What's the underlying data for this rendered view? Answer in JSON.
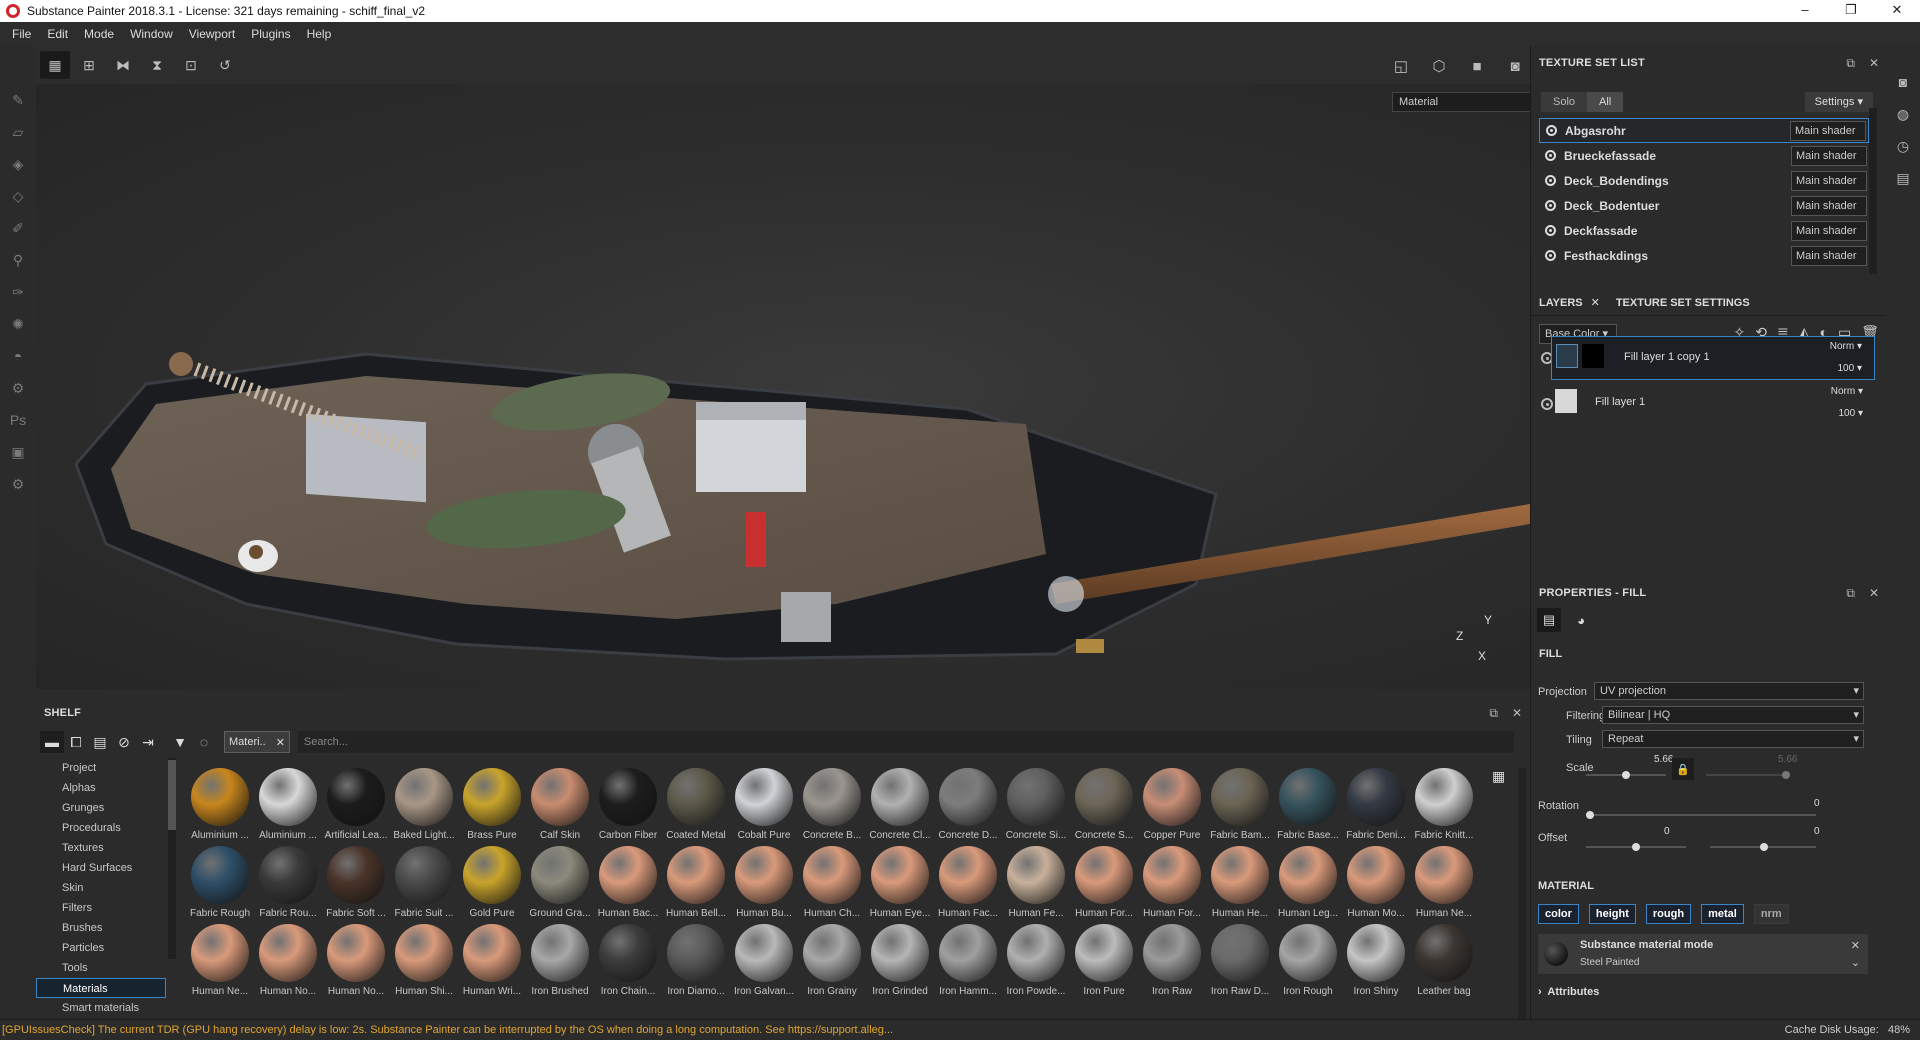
{
  "window": {
    "title": "Substance Painter 2018.3.1 - License: 321 days remaining - schiff_final_v2",
    "controls": [
      "–",
      "❐",
      "✕"
    ]
  },
  "menu": [
    "File",
    "Edit",
    "Mode",
    "Window",
    "Viewport",
    "Plugins",
    "Help"
  ],
  "viewport": {
    "mode_select": "Material",
    "axes": {
      "z": "Z",
      "y": "Y",
      "x": "X"
    }
  },
  "shelf": {
    "title": "SHELF",
    "filter_chip": "Materi..",
    "search_placeholder": "Search...",
    "categories": [
      "Project",
      "Alphas",
      "Grunges",
      "Procedurals",
      "Textures",
      "Hard Surfaces",
      "Skin",
      "Filters",
      "Brushes",
      "Particles",
      "Tools",
      "Materials",
      "Smart materials"
    ],
    "selected_category": "Materials",
    "materials": [
      {
        "label": "Aluminium ...",
        "color": "#c8861c"
      },
      {
        "label": "Aluminium ...",
        "color": "#d8d8d8"
      },
      {
        "label": "Artificial Lea...",
        "color": "#1c1c1c"
      },
      {
        "label": "Baked Light...",
        "color": "#a89786"
      },
      {
        "label": "Brass Pure",
        "color": "#c9a42c"
      },
      {
        "label": "Calf Skin",
        "color": "#c98c6f"
      },
      {
        "label": "Carbon Fiber",
        "color": "#1d1d1d"
      },
      {
        "label": "Coated Metal",
        "color": "#5d5a4a"
      },
      {
        "label": "Cobalt Pure",
        "color": "#cfd2d6"
      },
      {
        "label": "Concrete B...",
        "color": "#9a958f"
      },
      {
        "label": "Concrete Cl...",
        "color": "#b1b1b1"
      },
      {
        "label": "Concrete D...",
        "color": "#7d7d7d"
      },
      {
        "label": "Concrete Si...",
        "color": "#5f5f5f"
      },
      {
        "label": "Concrete S...",
        "color": "#6d6658"
      },
      {
        "label": "Copper Pure",
        "color": "#c78d76"
      },
      {
        "label": "Fabric Bam...",
        "color": "#6b6454"
      },
      {
        "label": "Fabric Base...",
        "color": "#36535d"
      },
      {
        "label": "Fabric Deni...",
        "color": "#343a44"
      },
      {
        "label": "Fabric Knitt...",
        "color": "#cfcfcf"
      },
      {
        "label": "Fabric Rough",
        "color": "#2e4f68"
      },
      {
        "label": "Fabric Rou...",
        "color": "#3a3a3a"
      },
      {
        "label": "Fabric Soft ...",
        "color": "#4a3429"
      },
      {
        "label": "Fabric Suit ...",
        "color": "#4a4a4a"
      },
      {
        "label": "Gold Pure",
        "color": "#c9a42c"
      },
      {
        "label": "Ground Gra...",
        "color": "#8c8a7c"
      },
      {
        "label": "Human Bac...",
        "color": "#d99a7b"
      },
      {
        "label": "Human Bell...",
        "color": "#d99a7b"
      },
      {
        "label": "Human Bu...",
        "color": "#d99a7b"
      },
      {
        "label": "Human Ch...",
        "color": "#d99a7b"
      },
      {
        "label": "Human Eye...",
        "color": "#d99a7b"
      },
      {
        "label": "Human Fac...",
        "color": "#d99a7b"
      },
      {
        "label": "Human Fe...",
        "color": "#c8b19b"
      },
      {
        "label": "Human For...",
        "color": "#d99a7b"
      },
      {
        "label": "Human For...",
        "color": "#d99a7b"
      },
      {
        "label": "Human He...",
        "color": "#d99a7b"
      },
      {
        "label": "Human Leg...",
        "color": "#d99a7b"
      },
      {
        "label": "Human Mo...",
        "color": "#d99a7b"
      },
      {
        "label": "Human Ne...",
        "color": "#d99a7b"
      },
      {
        "label": "Human Ne...",
        "color": "#d99a7b"
      },
      {
        "label": "Human No...",
        "color": "#d99a7b"
      },
      {
        "label": "Human No...",
        "color": "#d99a7b"
      },
      {
        "label": "Human Shi...",
        "color": "#d99a7b"
      },
      {
        "label": "Human Wri...",
        "color": "#d99a7b"
      },
      {
        "label": "Iron Brushed",
        "color": "#a8a8a8"
      },
      {
        "label": "Iron Chain...",
        "color": "#3c3c3c"
      },
      {
        "label": "Iron Diamo...",
        "color": "#5a5a5a"
      },
      {
        "label": "Iron Galvan...",
        "color": "#b9b9b9"
      },
      {
        "label": "Iron Grainy",
        "color": "#a8a8a8"
      },
      {
        "label": "Iron Grinded",
        "color": "#b5b5b5"
      },
      {
        "label": "Iron Hamm...",
        "color": "#a0a0a0"
      },
      {
        "label": "Iron Powde...",
        "color": "#b0b0b0"
      },
      {
        "label": "Iron Pure",
        "color": "#bcbcbc"
      },
      {
        "label": "Iron Raw",
        "color": "#9a9a9a"
      },
      {
        "label": "Iron Raw D...",
        "color": "#6a6a6a"
      },
      {
        "label": "Iron Rough",
        "color": "#a5a5a5"
      },
      {
        "label": "Iron Shiny",
        "color": "#c5c5c5"
      },
      {
        "label": "Leather bag",
        "color": "#3c3632"
      }
    ]
  },
  "texture_set_list": {
    "title": "TEXTURE SET LIST",
    "solo": "Solo",
    "all": "All",
    "settings": "Settings",
    "sets": [
      {
        "name": "Abgasrohr",
        "shader": "Main shader"
      },
      {
        "name": "Brueckefassade",
        "shader": "Main shader"
      },
      {
        "name": "Deck_Bodendings",
        "shader": "Main shader"
      },
      {
        "name": "Deck_Bodentuer",
        "shader": "Main shader"
      },
      {
        "name": "Deckfassade",
        "shader": "Main shader"
      },
      {
        "name": "Festhackdings",
        "shader": "Main shader"
      }
    ]
  },
  "layers": {
    "tab_layers": "LAYERS",
    "tab_settings": "TEXTURE SET SETTINGS",
    "channel": "Base Color",
    "items": [
      {
        "name": "Fill layer 1 copy 1",
        "blend": "Norm",
        "opacity": "100"
      },
      {
        "name": "Fill layer 1",
        "blend": "Norm",
        "opacity": "100"
      }
    ]
  },
  "properties": {
    "title": "PROPERTIES - FILL",
    "fill_section": "FILL",
    "projection_label": "Projection",
    "projection_value": "UV projection",
    "filtering_label": "Filtering",
    "filtering_value": "Bilinear | HQ",
    "tiling_label": "Tiling",
    "tiling_value": "Repeat",
    "scale_label": "Scale",
    "scale_value": "5.66",
    "scale_value2": "5.66",
    "scale_fraction": 0.45,
    "rotation_label": "Rotation",
    "rotation_value": "0",
    "offset_label": "Offset",
    "offset_x": "0",
    "offset_y": "0",
    "material_section": "MATERIAL",
    "channels": [
      "color",
      "height",
      "rough",
      "metal",
      "nrm"
    ],
    "sm_title": "Substance material mode",
    "sm_value": "Steel Painted",
    "attributes": "Attributes"
  },
  "status": {
    "message": "[GPUIssuesCheck] The current TDR (GPU hang recovery) delay is low: 2s. Substance Painter can be interrupted by the OS when doing a long computation. See https://support.alleg...",
    "cache_label": "Cache Disk Usage:",
    "cache_value": "48%"
  }
}
